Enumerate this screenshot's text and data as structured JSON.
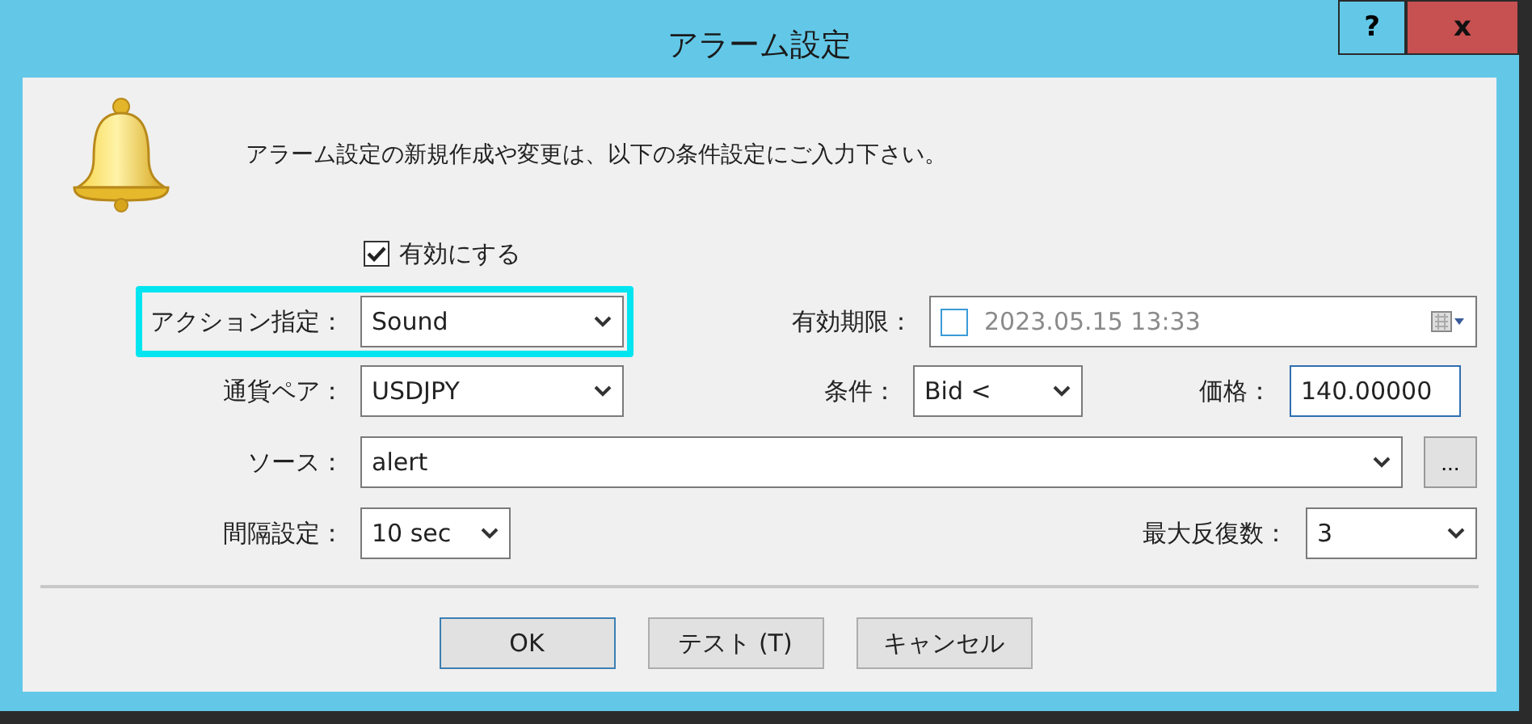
{
  "window": {
    "title": "アラーム設定",
    "help_button": "?",
    "close_button": "x"
  },
  "message": "アラーム設定の新規作成や変更は、以下の条件設定にご入力下さい。",
  "enable": {
    "label": "有効にする",
    "checked": true
  },
  "rows": [
    [
      {
        "kind": "select",
        "label": "アクション指定：",
        "value": "Sound",
        "highlighted": true,
        "focused": false
      },
      {
        "kind": "date",
        "label": "有効期限：",
        "value": "2023.05.15 13:33",
        "checked": false,
        "highlighted": false,
        "focused": false
      }
    ],
    [
      {
        "kind": "select",
        "label": "通貨ペア：",
        "value": "USDJPY",
        "highlighted": false,
        "focused": false
      },
      {
        "kind": "select",
        "label": "条件：",
        "value": "Bid <",
        "highlighted": false,
        "focused": false
      },
      {
        "kind": "input",
        "label": "価格：",
        "value": "140.00000",
        "highlighted": false,
        "focused": true
      }
    ],
    [
      {
        "kind": "combo",
        "label": "ソース：",
        "value": "alert",
        "button": "...",
        "highlighted": false,
        "focused": false
      }
    ],
    [
      {
        "kind": "select",
        "label": "間隔設定：",
        "value": "10 sec",
        "highlighted": false,
        "focused": false
      },
      {
        "kind": "select",
        "label": "最大反復数：",
        "value": "3",
        "highlighted": false,
        "focused": false
      }
    ]
  ],
  "buttons": [
    {
      "label": "OK",
      "default": true
    },
    {
      "label": "テスト (T)",
      "default": false
    },
    {
      "label": "キャンセル",
      "default": false
    }
  ]
}
